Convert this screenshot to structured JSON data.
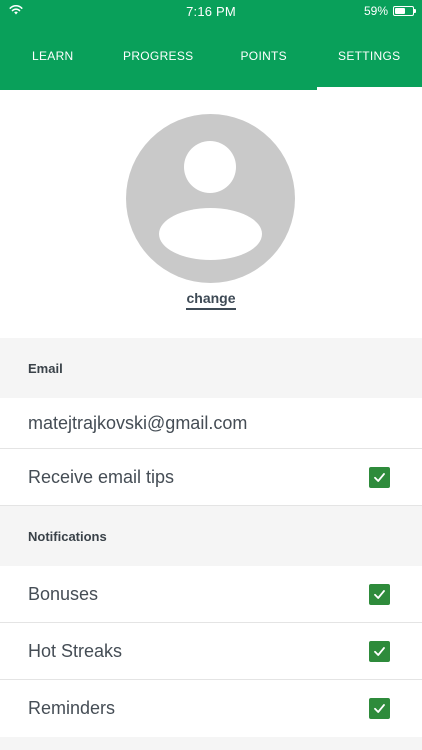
{
  "status_bar": {
    "time": "7:16 PM",
    "battery_text": "59%",
    "battery_level": 0.59
  },
  "tabs": [
    {
      "label": "LEARN",
      "active": false
    },
    {
      "label": "PROGRESS",
      "active": false
    },
    {
      "label": "POINTS",
      "active": false
    },
    {
      "label": "SETTINGS",
      "active": true
    }
  ],
  "profile": {
    "change_label": "change"
  },
  "email_section": {
    "header": "Email",
    "address": "matejtrajkovski@gmail.com",
    "tips_label": "Receive email tips",
    "tips_checked": true
  },
  "notifications_section": {
    "header": "Notifications",
    "items": [
      {
        "label": "Bonuses",
        "checked": true
      },
      {
        "label": "Hot Streaks",
        "checked": true
      },
      {
        "label": "Reminders",
        "checked": true
      }
    ]
  },
  "colors": {
    "accent": "#09a05a",
    "checkbox": "#2e8b3b",
    "section_bg": "#f5f5f5"
  },
  "icons": {
    "wifi": "wifi-icon",
    "battery": "battery-icon",
    "checkmark": "checkmark-icon",
    "avatar": "person-placeholder-icon"
  }
}
